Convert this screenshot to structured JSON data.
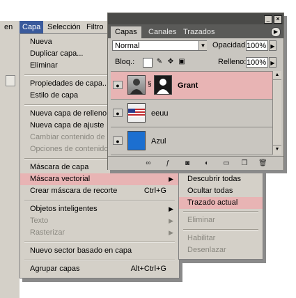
{
  "menubar": {
    "items": [
      {
        "label": "en"
      },
      {
        "label": "Capa"
      },
      {
        "label": "Selección"
      },
      {
        "label": "Filtro"
      }
    ]
  },
  "menu": {
    "items": [
      {
        "label": "Nueva",
        "enabled": true
      },
      {
        "label": "Duplicar capa...",
        "enabled": true
      },
      {
        "label": "Eliminar",
        "enabled": true
      },
      {
        "label": "Propiedades de capa...",
        "enabled": true
      },
      {
        "label": "Estilo de capa",
        "enabled": true
      },
      {
        "label": "Nueva capa de relleno",
        "enabled": true
      },
      {
        "label": "Nueva capa de ajuste",
        "enabled": true
      },
      {
        "label": "Cambiar contenido de c",
        "enabled": false
      },
      {
        "label": "Opciones de contenido",
        "enabled": false
      },
      {
        "label": "Máscara de capa",
        "enabled": true
      },
      {
        "label": "Máscara vectorial",
        "enabled": true,
        "highlighted": true
      },
      {
        "label": "Crear máscara de recorte",
        "shortcut": "Ctrl+G",
        "enabled": true
      },
      {
        "label": "Objetos inteligentes",
        "enabled": true
      },
      {
        "label": "Texto",
        "enabled": false
      },
      {
        "label": "Rasterizar",
        "enabled": false
      },
      {
        "label": "Nuevo sector basado en capa",
        "enabled": true
      },
      {
        "label": "Agrupar capas",
        "shortcut": "Alt+Ctrl+G",
        "enabled": true
      }
    ],
    "submenu_arrow": "▶"
  },
  "submenu": {
    "items": [
      {
        "label": "Descubrir todas",
        "enabled": true
      },
      {
        "label": "Ocultar todas",
        "enabled": true
      },
      {
        "label": "Trazado actual",
        "enabled": true,
        "highlighted": true
      },
      {
        "label": "Eliminar",
        "enabled": false
      },
      {
        "label": "Habilitar",
        "enabled": false
      },
      {
        "label": "Desenlazar",
        "enabled": false
      }
    ]
  },
  "palette": {
    "tabs": [
      "Capas",
      "Canales",
      "Trazados"
    ],
    "blend_mode": "Normal",
    "opacity_label": "Opacidad:",
    "opacity_value": "100%",
    "lock_label": "Bloq.:",
    "fill_label": "Relleno:",
    "fill_value": "100%",
    "layers": [
      {
        "name": "Grant",
        "selected": true,
        "thumb": "photo-silhouette"
      },
      {
        "name": "eeuu",
        "selected": false,
        "thumb": "us-flag"
      },
      {
        "name": "Azul",
        "selected": false,
        "thumb": "solid-blue"
      }
    ],
    "colors": {
      "selected_row": "#e8b4b4",
      "blue_layer": "#1c6fd0",
      "titlebar": "#4a4a48"
    }
  },
  "icons": {
    "eye": "eye-icon",
    "link": "link-icon",
    "menu": "flyout-menu-icon"
  }
}
